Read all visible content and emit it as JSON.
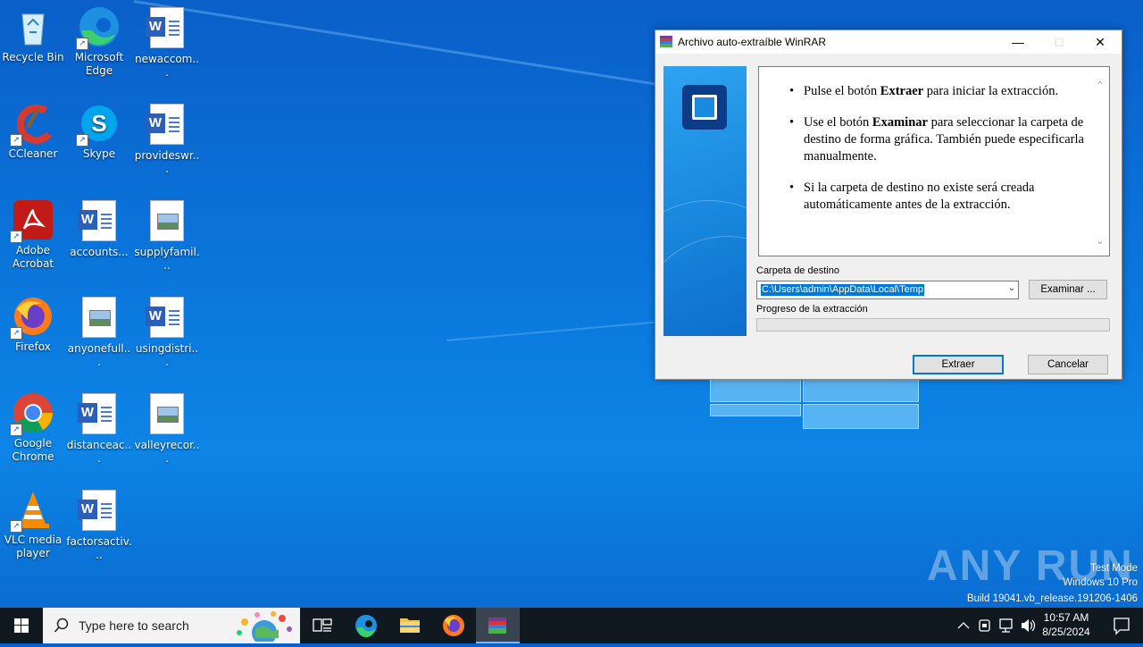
{
  "desktop": {
    "icons": [
      {
        "label": "Recycle Bin",
        "icon": "recycle-bin-icon"
      },
      {
        "label": "Microsoft Edge",
        "icon": "edge-icon"
      },
      {
        "label": "newaccom...",
        "icon": "word-doc-icon"
      },
      {
        "label": "CCleaner",
        "icon": "ccleaner-icon"
      },
      {
        "label": "Skype",
        "icon": "skype-icon"
      },
      {
        "label": "provideswr...",
        "icon": "word-doc-icon"
      },
      {
        "label": "Adobe Acrobat",
        "icon": "acrobat-icon"
      },
      {
        "label": "accounts...",
        "icon": "word-doc-icon"
      },
      {
        "label": "supplyfamil...",
        "icon": "image-file-icon"
      },
      {
        "label": "Firefox",
        "icon": "firefox-icon"
      },
      {
        "label": "anyonefull...",
        "icon": "image-file-icon"
      },
      {
        "label": "usingdistri...",
        "icon": "word-doc-icon"
      },
      {
        "label": "Google Chrome",
        "icon": "chrome-icon"
      },
      {
        "label": "distanceac...",
        "icon": "word-doc-icon"
      },
      {
        "label": "valleyrecor...",
        "icon": "image-file-icon"
      },
      {
        "label": "VLC media player",
        "icon": "vlc-icon"
      },
      {
        "label": "factorsactiv...",
        "icon": "word-doc-icon"
      }
    ]
  },
  "dialog": {
    "title": "Archivo auto-extraíble WinRAR",
    "bullets": [
      {
        "pre": "Pulse el botón ",
        "bold": "Extraer",
        "post": " para iniciar la extracción."
      },
      {
        "pre": "Use el botón ",
        "bold": "Examinar",
        "post": " para seleccionar la carpeta de destino de forma gráfica. También puede especificarla manualmente."
      },
      {
        "pre": "Si la carpeta de destino no existe será creada automáticamente antes de la extracción.",
        "bold": "",
        "post": ""
      }
    ],
    "dest_label": "Carpeta de destino",
    "dest_value": "C:\\Users\\admin\\AppData\\Local\\Temp",
    "browse_label": "Examinar ...",
    "progress_label": "Progreso de la extracción",
    "progress": 0,
    "extract_label": "Extraer",
    "cancel_label": "Cancelar"
  },
  "watermark": {
    "brand": "ANY RUN",
    "line1": "Test Mode",
    "line2": "Windows 10 Pro",
    "line3": "Build 19041.vb_release.191206-1406"
  },
  "taskbar": {
    "search_placeholder": "Type here to search",
    "time": "10:57 AM",
    "date": "8/25/2024"
  }
}
